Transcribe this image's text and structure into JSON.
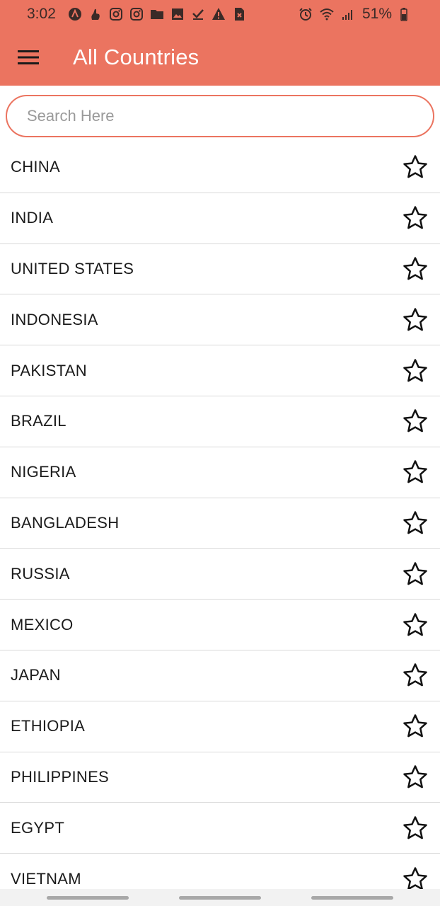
{
  "status_bar": {
    "time": "3:02",
    "battery_percent": "51%",
    "left_icons": [
      "app-badge-icon",
      "hand-icon",
      "instagram-icon",
      "instagram-icon",
      "folder-icon",
      "image-icon",
      "download-check-icon",
      "warning-icon",
      "blocked-file-icon"
    ],
    "right_icons": [
      "alarm-icon",
      "wifi-icon",
      "signal-icon",
      "battery-icon"
    ]
  },
  "app_bar": {
    "title": "All Countries",
    "menu_icon": "hamburger-menu-icon",
    "background_color": "#EB7460"
  },
  "search": {
    "placeholder": "Search Here",
    "value": ""
  },
  "countries": [
    {
      "name": "CHINA",
      "favorite": false
    },
    {
      "name": "INDIA",
      "favorite": false
    },
    {
      "name": "UNITED STATES",
      "favorite": false
    },
    {
      "name": "INDONESIA",
      "favorite": false
    },
    {
      "name": "PAKISTAN",
      "favorite": false
    },
    {
      "name": "BRAZIL",
      "favorite": false
    },
    {
      "name": "NIGERIA",
      "favorite": false
    },
    {
      "name": "BANGLADESH",
      "favorite": false
    },
    {
      "name": "RUSSIA",
      "favorite": false
    },
    {
      "name": "MEXICO",
      "favorite": false
    },
    {
      "name": "JAPAN",
      "favorite": false
    },
    {
      "name": "ETHIOPIA",
      "favorite": false
    },
    {
      "name": "PHILIPPINES",
      "favorite": false
    },
    {
      "name": "EGYPT",
      "favorite": false
    },
    {
      "name": "VIETNAM",
      "favorite": false
    }
  ],
  "nav_bar": {
    "pills": 3
  }
}
